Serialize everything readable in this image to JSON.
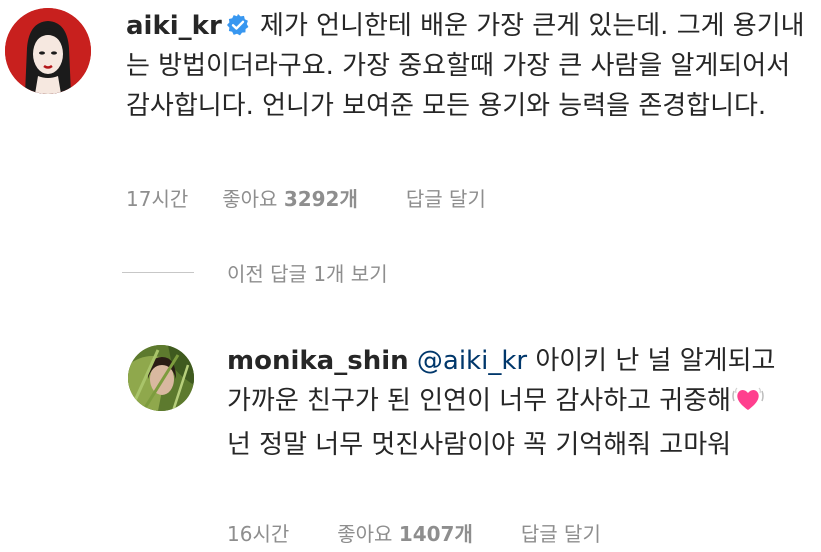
{
  "comment": {
    "username": "aiki_kr",
    "text": "제가 언니한테 배운 가장 큰게 있는데. 그게 용기내는 방법이더라구요. 가장 중요할때 가장 큰 사람을 알게되어서 감사합니다. 언니가 보여준 모든 용기와 능력을 존경합니다.",
    "time": "17시간",
    "likes_label": "좋아요",
    "likes_count": "3292개",
    "reply_label": "답글 달기"
  },
  "view_replies": "이전 답글 1개 보기",
  "reply": {
    "username": "monika_shin",
    "mention": "@aiki_kr",
    "text_part1": "아이키 난 널 알게되고 가까운 친구가 된 인연이 너무 감사하고 귀중해",
    "text_part2": "넌 정말 너무 멋진사람이야 꼭 기억해줘 고마워",
    "time": "16시간",
    "likes_label": "좋아요",
    "likes_count": "1407개",
    "reply_label": "답글 달기"
  },
  "colors": {
    "verified": "#3897f0",
    "mention": "#00376b",
    "meta": "#8e8e8e",
    "heart": "#ff3f8e"
  }
}
